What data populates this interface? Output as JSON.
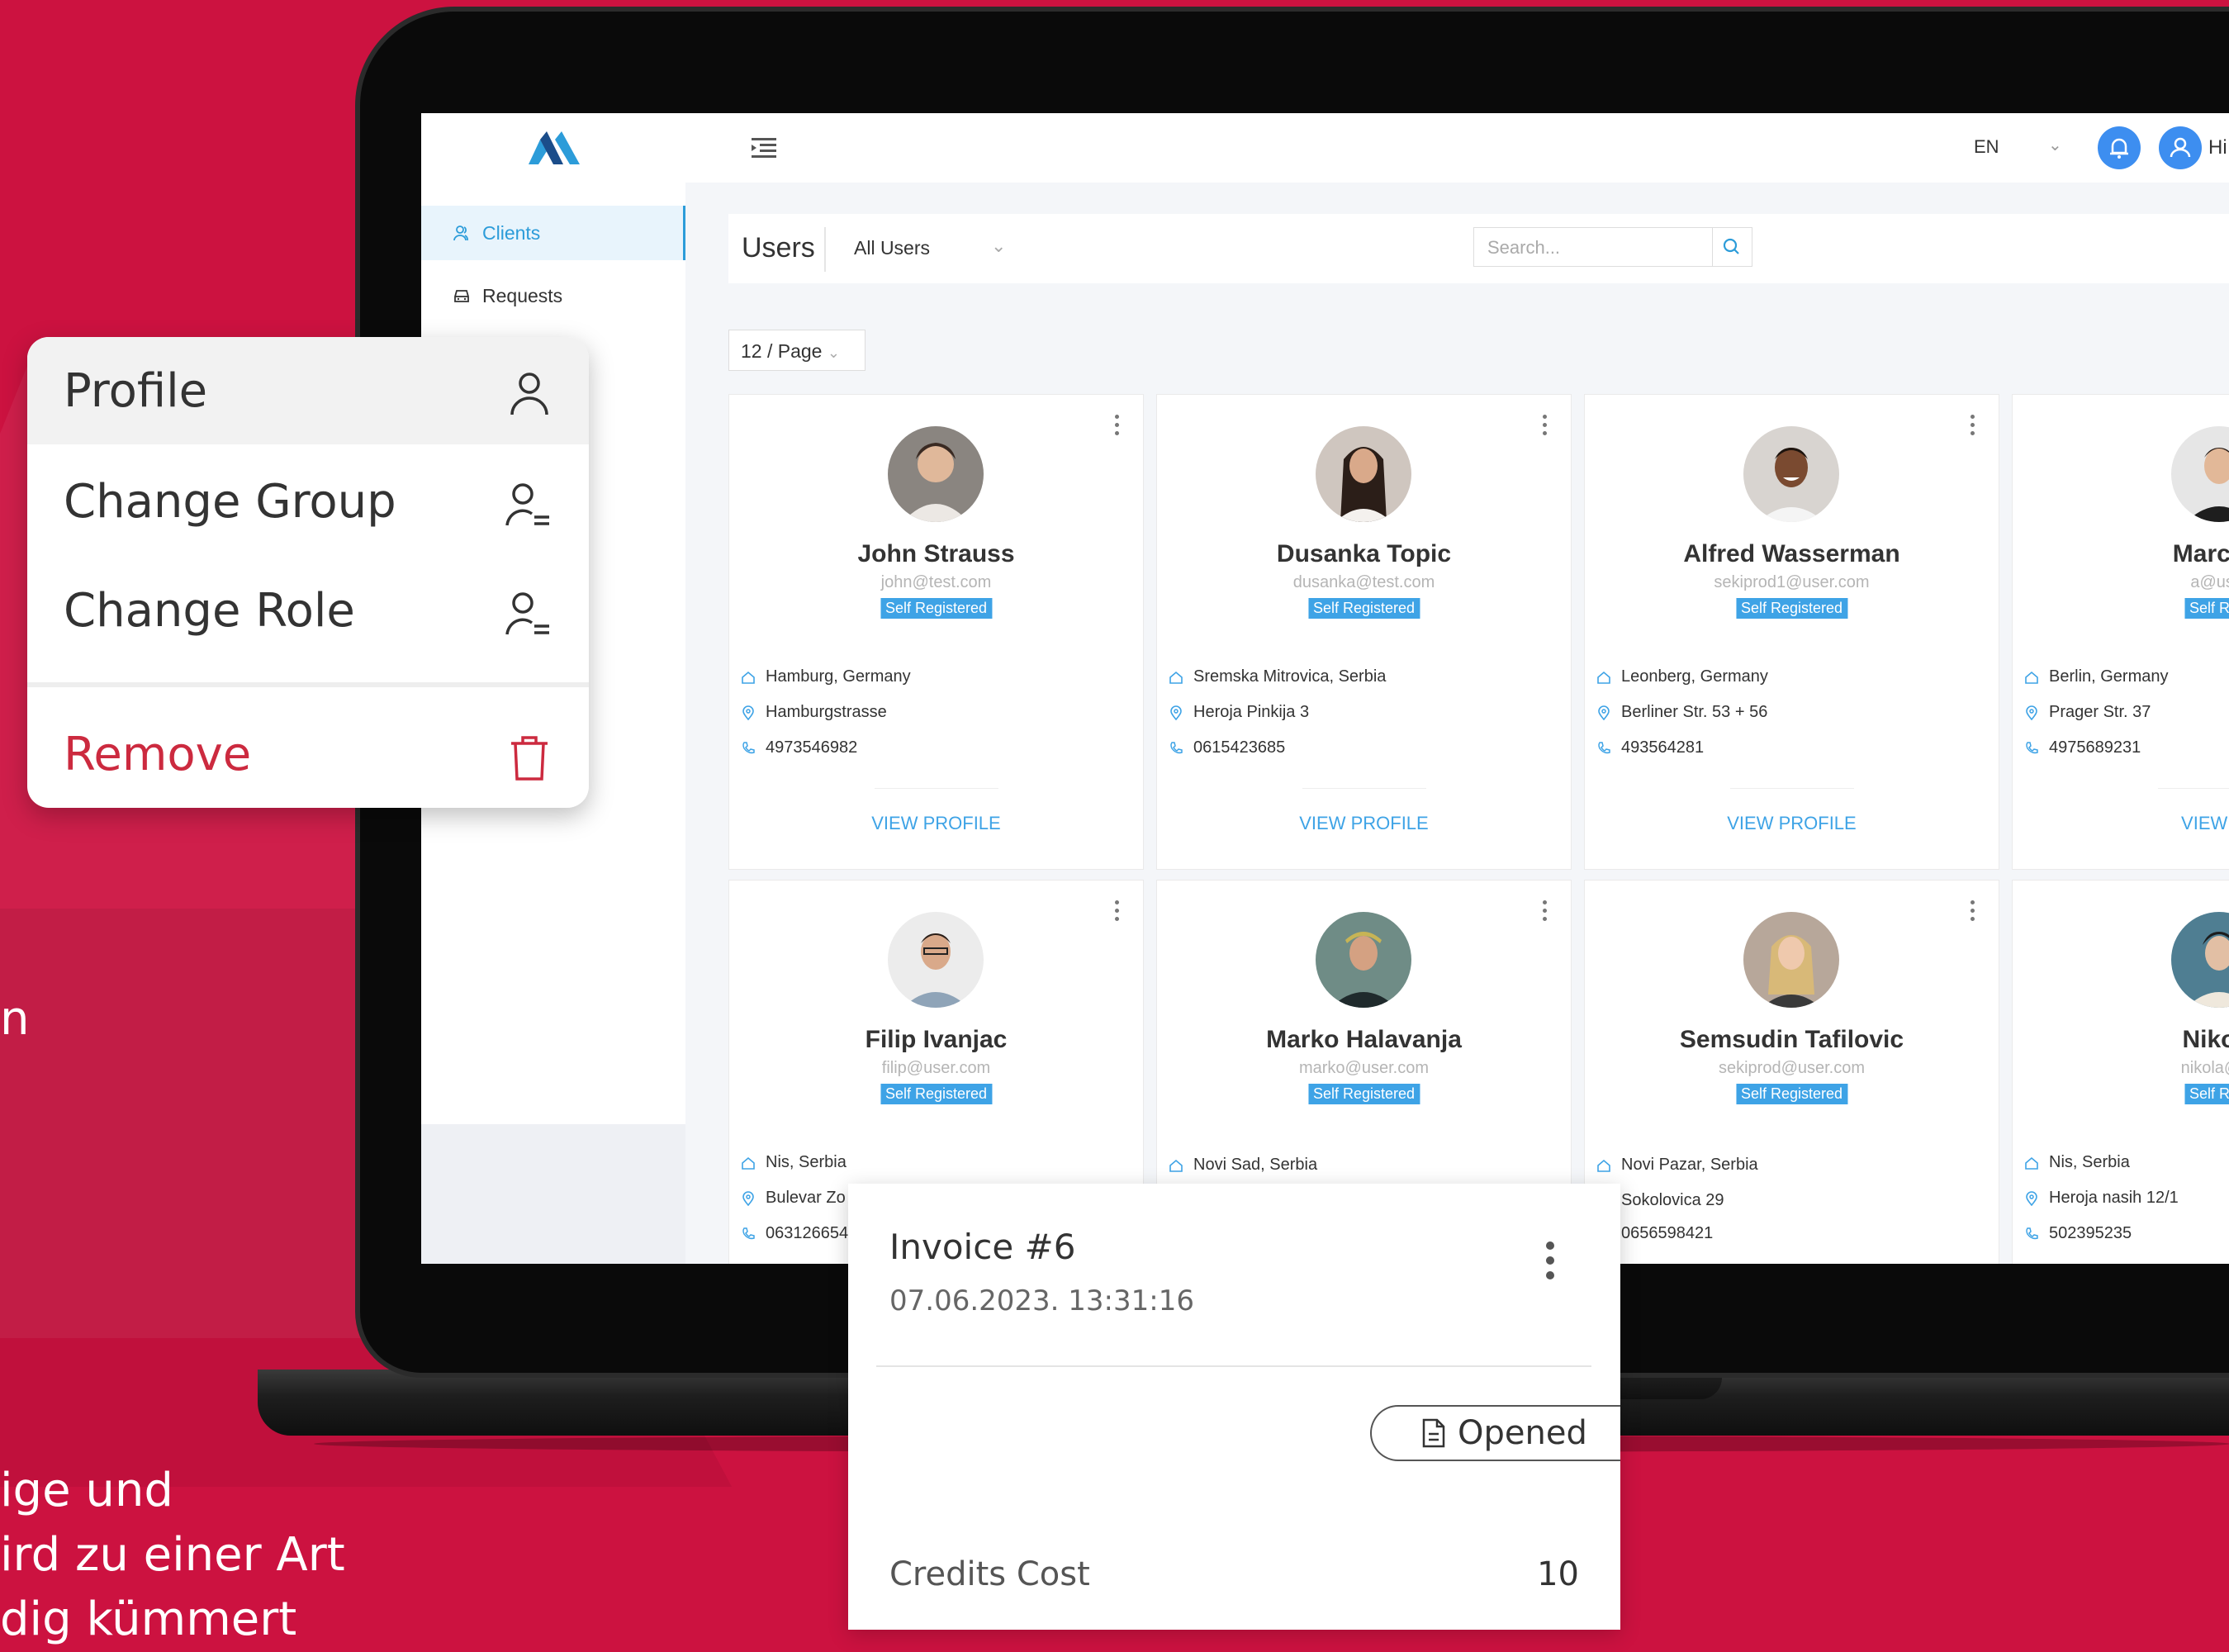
{
  "background_text": {
    "fragment_n": "n",
    "line1": "ige und",
    "line2": "ird zu einer Art",
    "line3": "dig kümmert"
  },
  "header": {
    "language": "EN",
    "greeting": "Hi"
  },
  "sidebar": {
    "items": [
      {
        "label": "Clients"
      },
      {
        "label": "Requests"
      }
    ]
  },
  "panel": {
    "title": "Users",
    "filter_value": "All Users",
    "search_placeholder": "Search...",
    "per_page": "12 / Page"
  },
  "cards": [
    {
      "name": "John Strauss",
      "email": "john@test.com",
      "badge": "Self Registered",
      "city": "Hamburg, Germany",
      "street": "Hamburgstrasse",
      "phone": "4973546982",
      "view": "VIEW PROFILE"
    },
    {
      "name": "Dusanka Topic",
      "email": "dusanka@test.com",
      "badge": "Self Registered",
      "city": "Sremska Mitrovica, Serbia",
      "street": "Heroja Pinkija 3",
      "phone": "0615423685",
      "view": "VIEW PROFILE"
    },
    {
      "name": "Alfred Wasserman",
      "email": "sekiprod1@user.com",
      "badge": "Self Registered",
      "city": "Leonberg, Germany",
      "street": "Berliner Str. 53 + 56",
      "phone": "493564281",
      "view": "VIEW PROFILE"
    },
    {
      "name": "Marc Jo",
      "email": "a@user",
      "badge": "Self Regi",
      "city": "Berlin, Germany",
      "street": "Prager Str. 37",
      "phone": "4975689231",
      "view": "VIEW PR"
    },
    {
      "name": "Filip Ivanjac",
      "email": "filip@user.com",
      "badge": "Self Registered",
      "city": "Nis, Serbia",
      "street": "Bulevar Zo",
      "phone": "063126654"
    },
    {
      "name": "Marko Halavanja",
      "email": "marko@user.com",
      "badge": "Self Registered",
      "city": "Novi Sad, Serbia"
    },
    {
      "name": "Semsudin Tafilovic",
      "email": "sekiprod@user.com",
      "badge": "Self Registered",
      "city": "Novi Pazar, Serbia",
      "street": "Sokolovica 29",
      "phone": "0656598421"
    },
    {
      "name": "Nikola",
      "email": "nikola@us",
      "badge": "Self Regi",
      "city": "Nis, Serbia",
      "street": "Heroja nasih 12/1",
      "phone": "502395235"
    }
  ],
  "context_menu": {
    "profile": "Profile",
    "change_group": "Change Group",
    "change_role": "Change Role",
    "remove": "Remove"
  },
  "invoice": {
    "title": "Invoice #6",
    "date": "07.06.2023. 13:31:16",
    "status": "Opened",
    "credits_label": "Credits Cost",
    "credits_value": "10"
  },
  "colors": {
    "background": "#cc1240",
    "accent": "#3ea3e6",
    "remove": "#cc2a3f"
  }
}
